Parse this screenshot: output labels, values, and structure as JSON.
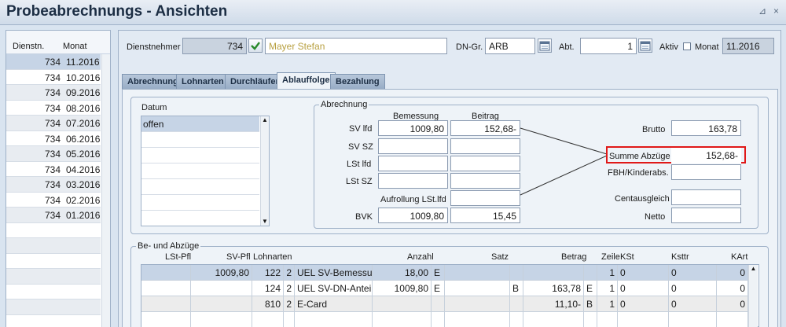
{
  "window": {
    "title": "Probeabrechnungs - Ansichten",
    "controls": "⊿ ×"
  },
  "left_list": {
    "headers": {
      "dienstn": "Dienstn.",
      "monat": "Monat"
    },
    "rows": [
      {
        "n": "734",
        "m": "11.2016"
      },
      {
        "n": "734",
        "m": "10.2016"
      },
      {
        "n": "734",
        "m": "09.2016"
      },
      {
        "n": "734",
        "m": "08.2016"
      },
      {
        "n": "734",
        "m": "07.2016"
      },
      {
        "n": "734",
        "m": "06.2016"
      },
      {
        "n": "734",
        "m": "05.2016"
      },
      {
        "n": "734",
        "m": "04.2016"
      },
      {
        "n": "734",
        "m": "03.2016"
      },
      {
        "n": "734",
        "m": "02.2016"
      },
      {
        "n": "734",
        "m": "01.2016"
      }
    ]
  },
  "header": {
    "dienstnehmer_label": "Dienstnehmer",
    "dienstnehmer_nr": "734",
    "dienstnehmer_name": "Mayer Stefan",
    "dngr_label": "DN-Gr.",
    "dngr_value": "ARB",
    "abt_label": "Abt.",
    "abt_value": "1",
    "aktiv_label": "Aktiv",
    "monat_label": "Monat",
    "monat_value": "11.2016"
  },
  "tabs": [
    "Abrechnung",
    "Lohnarten",
    "Durchläufer",
    "Ablauffolge",
    "Bezahlung"
  ],
  "datum": {
    "label": "Datum",
    "rows": [
      "offen"
    ]
  },
  "abrechnung": {
    "title": "Abrechnung",
    "col_bemessung": "Bemessung",
    "col_beitrag": "Beitrag",
    "rows": [
      {
        "label": "SV lfd",
        "bemessung": "1009,80",
        "beitrag": "152,68-"
      },
      {
        "label": "SV SZ",
        "bemessung": "",
        "beitrag": ""
      },
      {
        "label": "LSt lfd",
        "bemessung": "",
        "beitrag": ""
      },
      {
        "label": "LSt SZ",
        "bemessung": "",
        "beitrag": ""
      }
    ],
    "aufrollung_label": "Aufrollung LSt.lfd",
    "aufrollung_value": "",
    "bvk_label": "BVK",
    "bvk_bemessung": "1009,80",
    "bvk_beitrag": "15,45",
    "brutto_label": "Brutto",
    "brutto_value": "163,78",
    "summe_label": "Summe Abzüge",
    "summe_value": "152,68-",
    "fbh_label": "FBH/Kinderabs.",
    "fbh_value": "",
    "centaus_label": "Centausgleich",
    "centaus_value": "",
    "netto_label": "Netto",
    "netto_value": ""
  },
  "abzuege": {
    "title": "Be- und Abzüge",
    "headers": [
      "LSt-Pfl",
      "SV-Pfl",
      "Lohnarten",
      "Anzahl",
      "Satz",
      "Betrag",
      "Zeile",
      "KSt",
      "Ksttr",
      "KArt"
    ],
    "rows": [
      {
        "lst": "",
        "sv": "1009,80",
        "la": "122",
        "x": "2",
        "name": "UEL SV-Bemessung",
        "anzahl": "18,00",
        "e1": "E",
        "satz": "",
        "s2": "",
        "betrag": "",
        "b2": "",
        "zeile": "1",
        "kst": "0",
        "ksttr": "0",
        "kart": "0"
      },
      {
        "lst": "",
        "sv": "",
        "la": "124",
        "x": "2",
        "name": "UEL SV-DN-Anteil lfd",
        "anzahl": "1009,80",
        "e1": "E",
        "satz": "",
        "s2": "B",
        "betrag": "163,78",
        "b2": "E",
        "zeile": "1",
        "kst": "0",
        "ksttr": "0",
        "kart": "0"
      },
      {
        "lst": "",
        "sv": "",
        "la": "810",
        "x": "2",
        "name": "E-Card",
        "anzahl": "",
        "e1": "",
        "satz": "",
        "s2": "",
        "betrag": "11,10-",
        "b2": "B",
        "zeile": "1",
        "kst": "0",
        "ksttr": "0",
        "kart": "0"
      }
    ]
  },
  "colors": {
    "highlight_border": "#e01818",
    "selected_row": "#c6d4e6",
    "name_text": "#b8a040"
  }
}
